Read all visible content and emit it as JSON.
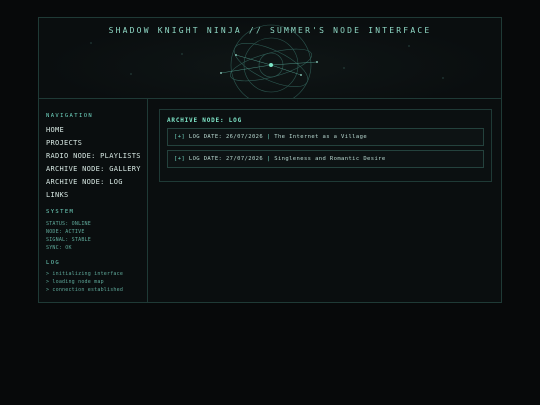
{
  "header": {
    "title": "SHADOW KNIGHT NINJA // SUMMER'S NODE INTERFACE"
  },
  "sidebar": {
    "navigation_title": "NAVIGATION",
    "nav_items": [
      {
        "label": "HOME"
      },
      {
        "label": "PROJECTS"
      },
      {
        "label": "RADIO NODE: PLAYLISTS"
      },
      {
        "label": "ARCHIVE NODE: GALLERY"
      },
      {
        "label": "ARCHIVE NODE: LOG"
      },
      {
        "label": "LINKS"
      }
    ],
    "system_title": "SYSTEM",
    "system_lines": [
      "STATUS: ONLINE",
      "NODE: ACTIVE",
      "SIGNAL: STABLE",
      "SYNC: OK"
    ],
    "log_title": "LOG",
    "log_lines": [
      "> initializing interface",
      "> loading node map",
      "> connection established"
    ]
  },
  "main": {
    "panel_title": "ARCHIVE NODE: LOG",
    "entries": [
      {
        "prefix": "[+]",
        "date_label": "LOG DATE: 26/07/2026",
        "separator": "|",
        "title": "The Internet as a Village"
      },
      {
        "prefix": "[+]",
        "date_label": "LOG DATE: 27/07/2026",
        "separator": "|",
        "title": "Singleness and Romantic Desire"
      }
    ]
  },
  "colors": {
    "background": "#07090a",
    "border": "#1f3a36",
    "accent": "#6fd3bf",
    "text": "#d6e7e2"
  }
}
